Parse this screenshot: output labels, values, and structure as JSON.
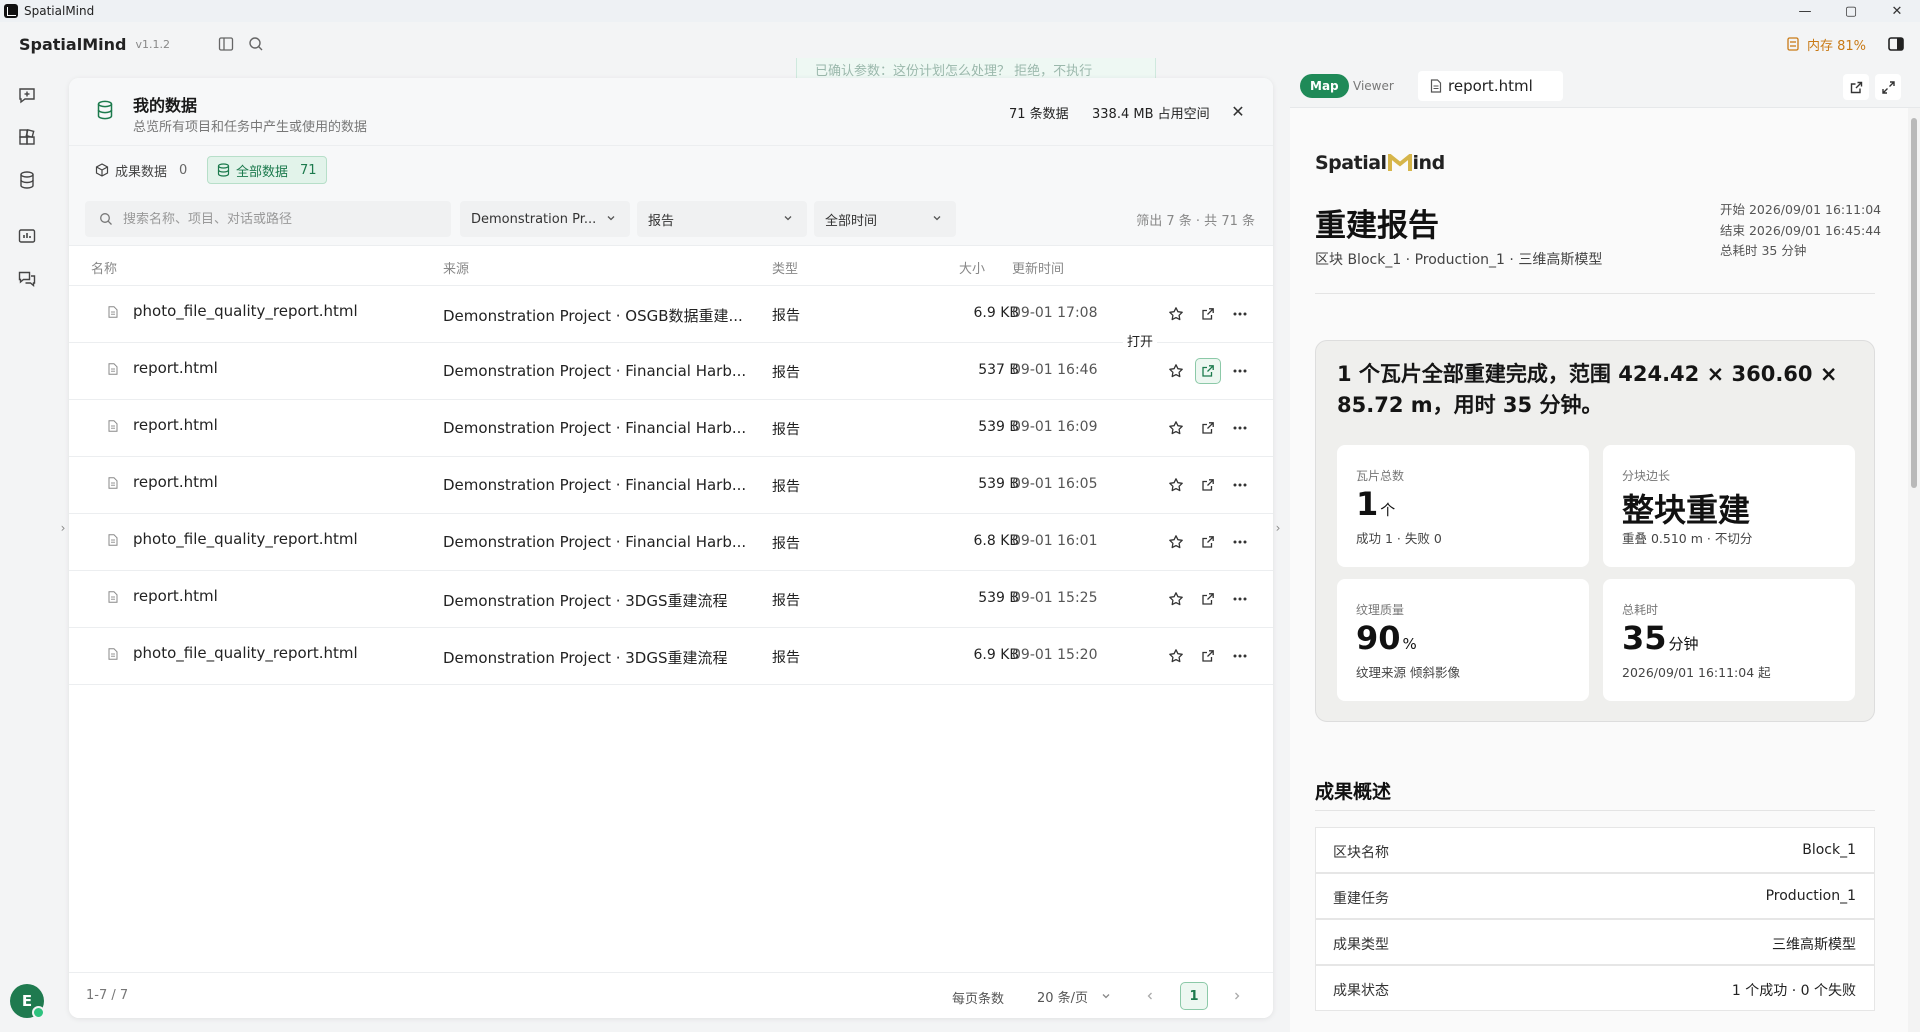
{
  "os": {
    "title": "SpatialMind",
    "controls": [
      "—",
      "▢",
      "✕"
    ]
  },
  "header": {
    "brand": "SpatialMind",
    "version": "v1.1.2",
    "memory": "内存 81%"
  },
  "bg_bubble": "已确认参数：这份计划怎么处理？ 拒绝，不执行",
  "panel": {
    "title": "我的数据",
    "subtitle": "总览所有项目和任务中产生或使用的数据",
    "count": "71 条数据",
    "size": "338.4 MB 占用空间",
    "close": "✕",
    "tabs": [
      {
        "label": "成果数据",
        "count": "0"
      },
      {
        "label": "全部数据",
        "count": "71"
      }
    ],
    "search_placeholder": "搜索名称、项目、对话或路径",
    "filters": {
      "project": "Demonstration Pr...",
      "type": "报告",
      "time": "全部时间"
    },
    "filter_summary": "筛出 7 条 · 共 71 条",
    "columns": {
      "name": "名称",
      "source": "来源",
      "type": "类型",
      "size": "大小",
      "updated": "更新时间"
    },
    "rows": [
      {
        "name": "photo_file_quality_report.html",
        "source": "Demonstration Project · OSGB数据重建...",
        "type": "报告",
        "size": "6.9 KB",
        "time": "09-01 17:08"
      },
      {
        "name": "report.html",
        "source": "Demonstration Project · Financial Harb...",
        "type": "报告",
        "size": "537 B",
        "time": "09-01 16:46"
      },
      {
        "name": "report.html",
        "source": "Demonstration Project · Financial Harb...",
        "type": "报告",
        "size": "539 B",
        "time": "09-01 16:09"
      },
      {
        "name": "report.html",
        "source": "Demonstration Project · Financial Harb...",
        "type": "报告",
        "size": "539 B",
        "time": "09-01 16:05"
      },
      {
        "name": "photo_file_quality_report.html",
        "source": "Demonstration Project · Financial Harb...",
        "type": "报告",
        "size": "6.8 KB",
        "time": "09-01 16:01"
      },
      {
        "name": "report.html",
        "source": "Demonstration Project · 3DGS重建流程",
        "type": "报告",
        "size": "539 B",
        "time": "09-01 15:25"
      },
      {
        "name": "photo_file_quality_report.html",
        "source": "Demonstration Project · 3DGS重建流程",
        "type": "报告",
        "size": "6.9 KB",
        "time": "09-01 15:20"
      }
    ],
    "tooltip": "打开",
    "footer": {
      "range": "1-7 / 7",
      "per_page_label": "每页条数",
      "per_page": "20 条/页",
      "page": "1"
    }
  },
  "viewer": {
    "mode_map": "Map",
    "mode_viewer": "Viewer",
    "doc_tab": "report.html",
    "report": {
      "logo_a": "Spatial",
      "logo_b": "ind",
      "title": "重建报告",
      "subtitle": "区块 Block_1 · Production_1 · 三维高斯模型",
      "start": "开始 2026/09/01 16:11:04",
      "end": "结束 2026/09/01 16:45:44",
      "duration": "总耗时 35 分钟",
      "summary": "1 个瓦片全部重建完成，范围 424.42 × 360.60 × 85.72 m，用时 35 分钟。",
      "kpis": [
        {
          "label": "瓦片总数",
          "value": "1",
          "unit": "个",
          "foot": "成功 1 · 失败 0"
        },
        {
          "label": "分块边长",
          "value": "整块重建",
          "unit": "",
          "foot": "重叠 0.510 m · 不切分"
        },
        {
          "label": "纹理质量",
          "value": "90",
          "unit": "%",
          "foot": "纹理来源 倾斜影像"
        },
        {
          "label": "总耗时",
          "value": "35",
          "unit": "分钟",
          "foot": "2026/09/01 16:11:04 起"
        }
      ],
      "section_title": "成果概述",
      "details": [
        {
          "k": "区块名称",
          "v": "Block_1"
        },
        {
          "k": "重建任务",
          "v": "Production_1"
        },
        {
          "k": "成果类型",
          "v": "三维高斯模型"
        },
        {
          "k": "成果状态",
          "v": "1 个成功 · 0 个失败"
        }
      ]
    }
  },
  "avatar": "E",
  "colors": {
    "accent": "#1f8a58",
    "accent_bg": "#e2f3ea",
    "memory": "#c97a16"
  }
}
